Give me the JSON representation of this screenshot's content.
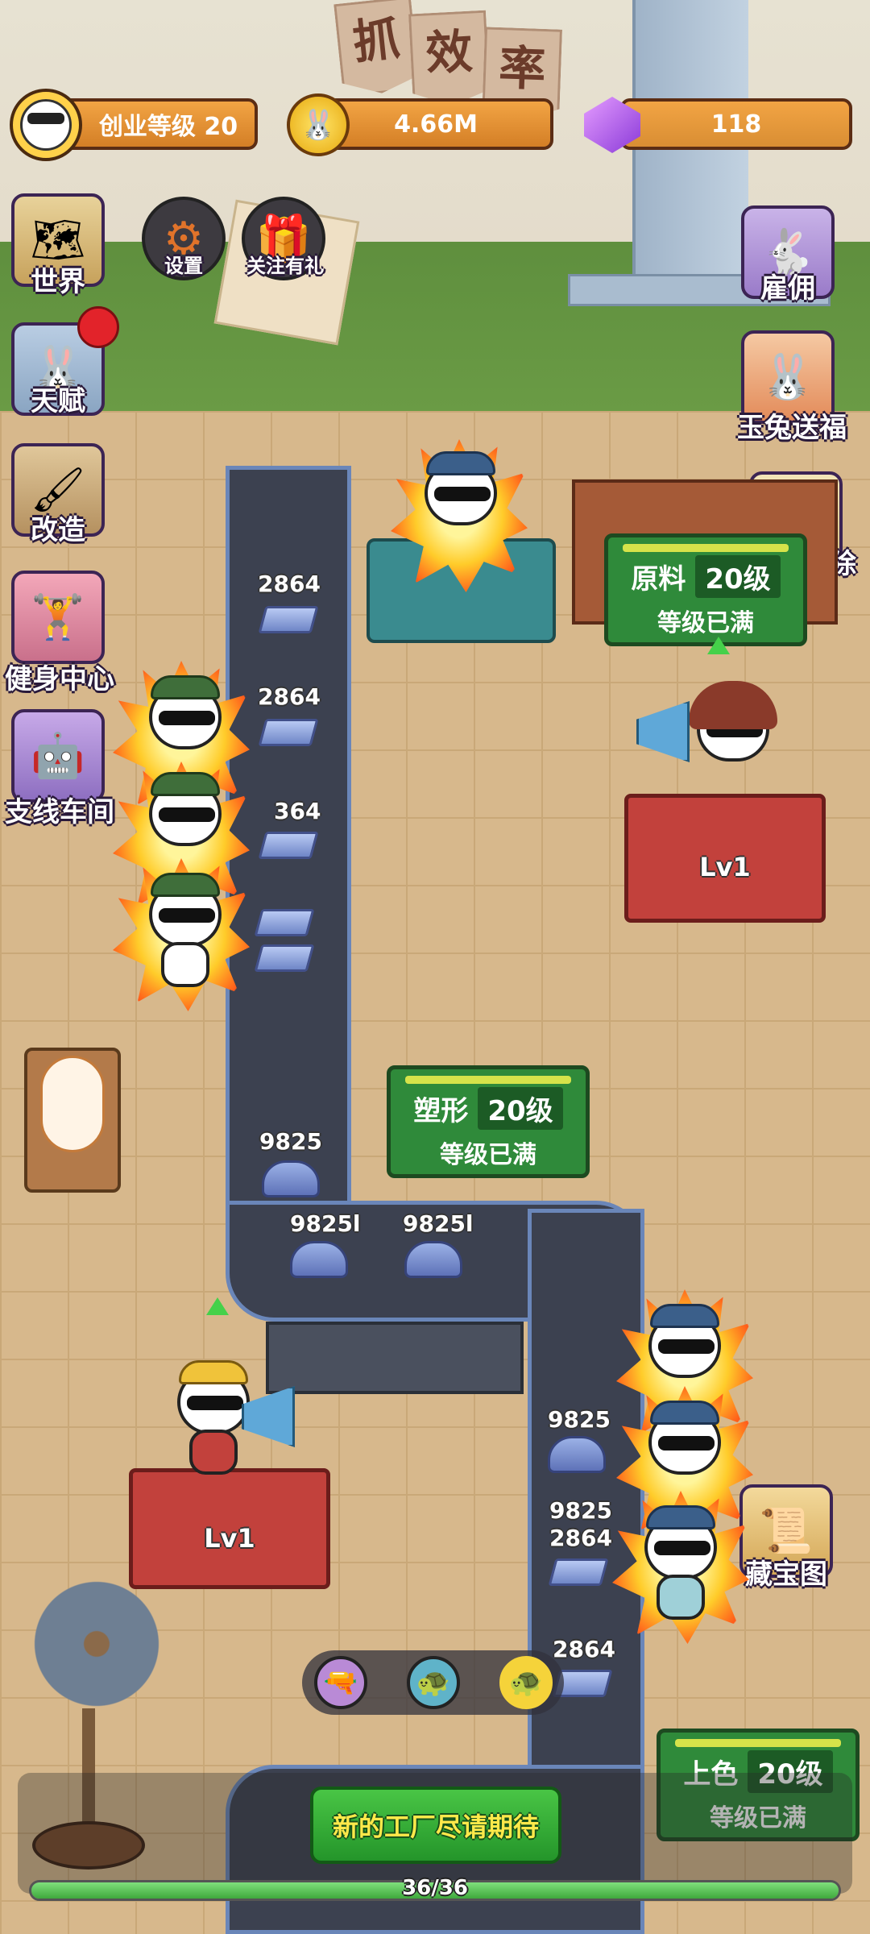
{
  "top_bar": {
    "level_label": "创业等级 20",
    "coins": "4.66M",
    "gems": "118"
  },
  "wall_banner": [
    "抓",
    "效",
    "率"
  ],
  "left_menu": {
    "world": "世界",
    "talent": "天赋",
    "upgrade": "改造",
    "gym": "健身中心",
    "branch_workshop": "支线车间"
  },
  "round_buttons": {
    "settings": "设置",
    "follow_gift": "关注有礼"
  },
  "right_menu": {
    "hire": "雇佣",
    "jade_rabbit": "玉兔送福",
    "rabbit_match": "兔克爱消除",
    "treasure_map": "藏宝图"
  },
  "stations": {
    "raw": {
      "name": "原料",
      "level": "20级",
      "status": "等级已满"
    },
    "shape": {
      "name": "塑形",
      "level": "20级",
      "status": "等级已满"
    },
    "color": {
      "name": "上色",
      "level": "20级",
      "status": "等级已满"
    }
  },
  "desks": {
    "top_right": "Lv1",
    "middle_left": "Lv1"
  },
  "belt_items": {
    "ingot_value": "2864",
    "ingot_value_partial": "364",
    "helmet_value": "9825",
    "helmet_value_overlap": "9825l"
  },
  "bottom": {
    "new_factory": "新的工厂尽请期待",
    "progress_text": "36/36",
    "progress_fraction": 1.0
  },
  "colors": {
    "station_green": "#2f8a3a",
    "desk_red": "#c2413c",
    "belt": "#3c4150",
    "top_bar_orange": "#e3922f"
  }
}
